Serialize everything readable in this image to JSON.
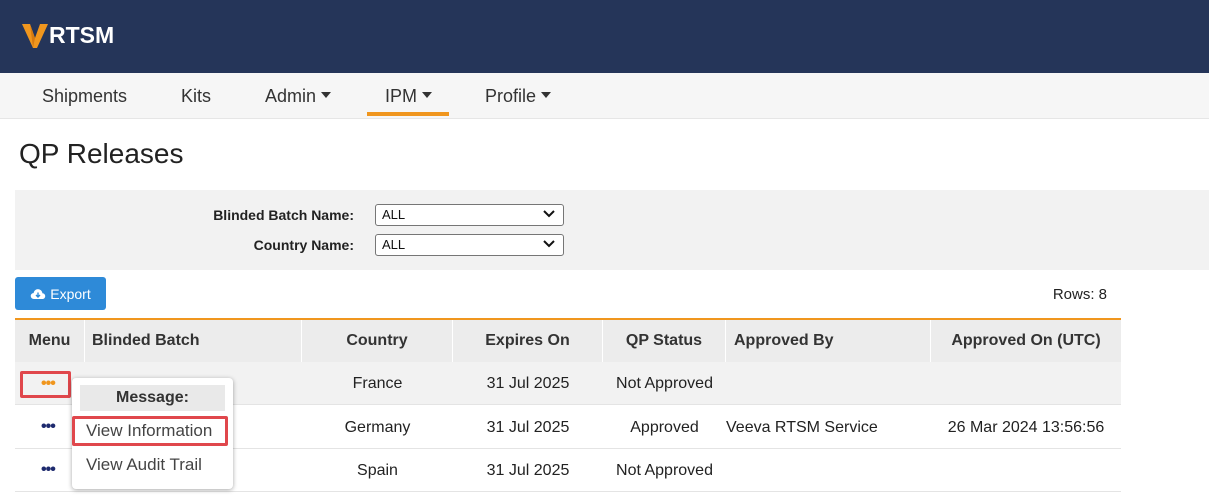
{
  "app": {
    "logo_text": "RTSM",
    "brand_color": "#f0961e",
    "header_bg": "#253559"
  },
  "nav": {
    "items": [
      {
        "label": "Shipments",
        "has_caret": false
      },
      {
        "label": "Kits",
        "has_caret": false
      },
      {
        "label": "Admin",
        "has_caret": true
      },
      {
        "label": "IPM",
        "has_caret": true,
        "active": true
      },
      {
        "label": "Profile",
        "has_caret": true
      }
    ]
  },
  "page": {
    "title": "QP Releases"
  },
  "filters": {
    "batch_label": "Blinded Batch Name:",
    "batch_value": "ALL",
    "country_label": "Country Name:",
    "country_value": "ALL"
  },
  "toolbar": {
    "export_label": "Export",
    "export_icon": "cloud-download-icon",
    "rows_label": "Rows: 8"
  },
  "table": {
    "columns": [
      "Menu",
      "Blinded Batch",
      "Country",
      "Expires On",
      "QP Status",
      "Approved By",
      "Approved On (UTC)"
    ],
    "rows": [
      {
        "batch": "",
        "country": "France",
        "expires": "31 Jul 2025",
        "status": "Not Approved",
        "approved_by": "",
        "approved_on": ""
      },
      {
        "batch": "",
        "country": "Germany",
        "expires": "31 Jul 2025",
        "status": "Approved",
        "approved_by": "Veeva RTSM Service",
        "approved_on": "26 Mar 2024 13:56:56"
      },
      {
        "batch": "",
        "country": "Spain",
        "expires": "31 Jul 2025",
        "status": "Not Approved",
        "approved_by": "",
        "approved_on": ""
      }
    ],
    "menu_glyph": "•••"
  },
  "popup": {
    "header": "Message:",
    "items": [
      "View Information",
      "View Audit Trail"
    ]
  }
}
